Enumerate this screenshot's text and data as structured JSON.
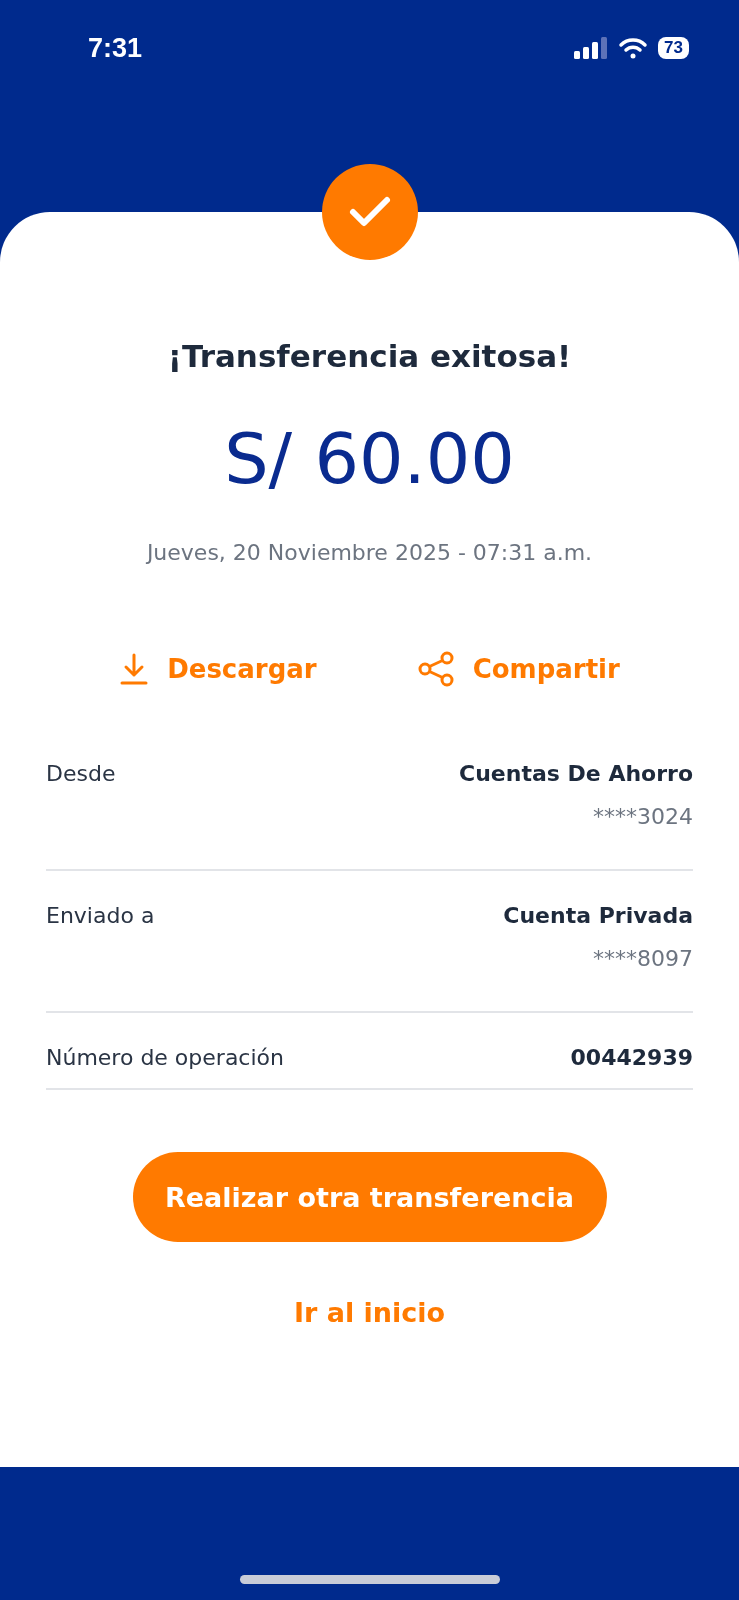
{
  "status_bar": {
    "time": "7:31",
    "battery": "73"
  },
  "title": "¡Transferencia exitosa!",
  "amount": "S/ 60.00",
  "date": "Jueves, 20 Noviembre 2025 - 07:31 a.m.",
  "actions": [
    {
      "kind": "download",
      "label": "Descargar"
    },
    {
      "kind": "share",
      "label": "Compartir"
    }
  ],
  "details": [
    {
      "label": "Desde",
      "value": "Cuentas De Ahorro",
      "sub": "****3024"
    },
    {
      "label": "Enviado a",
      "value": "Cuenta Privada",
      "sub": "****8097"
    },
    {
      "label": "Número de operación",
      "value": "00442939"
    }
  ],
  "primary_button": "Realizar otra transferencia",
  "link": "Ir al inicio"
}
